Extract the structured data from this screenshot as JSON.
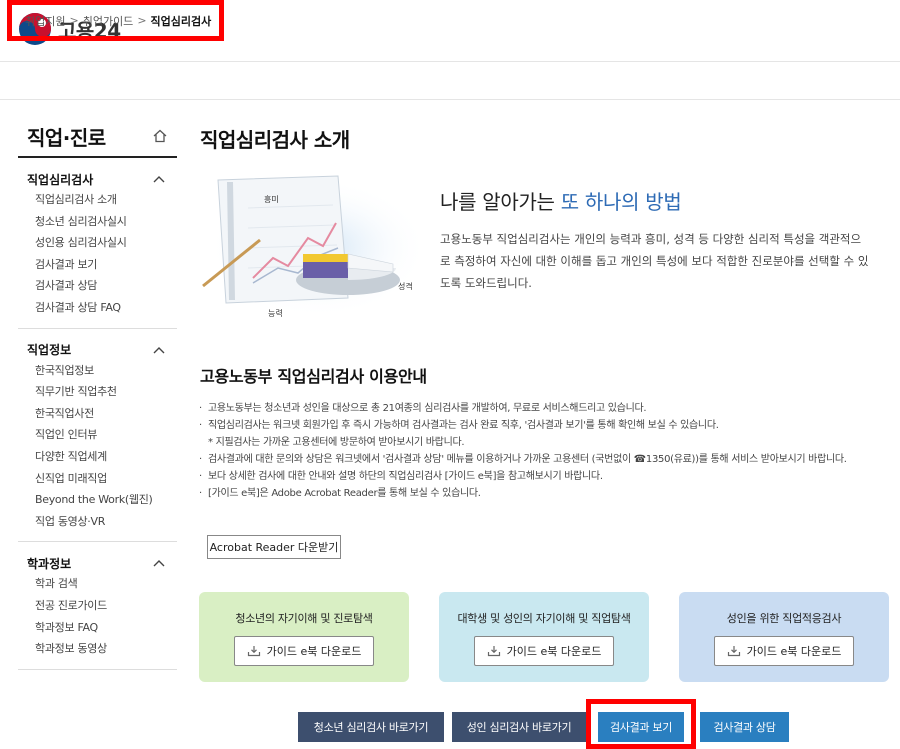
{
  "header": {
    "logo_text": "고용24",
    "logo_colors": {
      "red": "#c8102e",
      "blue": "#0e4a8a"
    }
  },
  "breadcrumb": {
    "items": [
      "취업지원",
      "취업가이드",
      "직업심리검사"
    ],
    "separator": ">"
  },
  "sidebar": {
    "title": "직업·진로",
    "groups": [
      {
        "label": "직업심리검사",
        "items": [
          "직업심리검사 소개",
          "청소년 심리검사실시",
          "성인용 심리검사실시",
          "검사결과 보기",
          "검사결과 상담",
          "검사결과 상담 FAQ"
        ]
      },
      {
        "label": "직업정보",
        "items": [
          "한국직업정보",
          "직무기반 직업추천",
          "한국직업사전",
          "직업인 인터뷰",
          "다양한 직업세계",
          "신직업 미래직업",
          "Beyond the Work(웹진)",
          "직업 동영상·VR"
        ]
      },
      {
        "label": "학과정보",
        "items": [
          "학과 검색",
          "전공 진로가이드",
          "학과정보 FAQ",
          "학과정보 동영상"
        ]
      }
    ]
  },
  "main": {
    "title": "직업심리검사 소개",
    "illustration_labels": {
      "interest": "흥미",
      "personality": "성격",
      "ability": "능력"
    },
    "intro": {
      "heading_prefix": "나를 알아가는 ",
      "heading_accent": "또 하나의 방법",
      "accent_color": "#2e6bb5",
      "body": "고용노동부 직업심리검사는 개인의 능력과 흥미, 성격 등 다양한 심리적 특성을 객관적으로 측정하여 자신에 대한 이해를 돕고 개인의 특성에 보다 적합한 진로분야를 선택할 수 있도록 도와드립니다."
    },
    "guide": {
      "title": "고용노동부 직업심리검사 이용안내",
      "bullets": [
        "고용노동부는 청소년과 성인을 대상으로 총 21여종의 심리검사를 개발하여, 무료로 서비스해드리고 있습니다.",
        "직업심리검사는 워크넷 회원가입 후 즉시 가능하며 검사결과는 검사 완료 직후, '검사결과 보기'를 통해 확인해 보실 수 있습니다.",
        "* 지필검사는 가까운 고용센터에 방문하여 받아보시기 바랍니다.",
        "검사결과에 대한 문의와 상담은 워크넷에서 '검사결과 상담' 메뉴를 이용하거나 가까운 고용센터 (국번없이 ☎1350(유료))를 통해 서비스 받아보시기 바랍니다.",
        "보다 상세한 검사에 대한 안내와 설명 하단의 직업심리검사 [가이드 e북]을 참고해보시기 바랍니다.",
        "[가이드 e북]은 Adobe Acrobat Reader를 통해 보실 수 있습니다."
      ],
      "acrobat_button": "Acrobat Reader 다운받기"
    },
    "cards": [
      {
        "title": "청소년의 자기이해 및 진로탐색",
        "button": "가이드 e북 다운로드",
        "bg": "#d9efc4"
      },
      {
        "title": "대학생 및 성인의 자기이해 및 직업탐색",
        "button": "가이드 e북 다운로드",
        "bg": "#c9e8f0"
      },
      {
        "title": "성인을 위한 직업적응검사",
        "button": "가이드 e북 다운로드",
        "bg": "#c9dcf2"
      }
    ],
    "bottom_buttons": [
      {
        "label": "청소년 심리검사 바로가기",
        "bg": "#3d4f6e"
      },
      {
        "label": "성인 심리검사 바로가기",
        "bg": "#3d4f6e"
      },
      {
        "label": "검사결과 보기",
        "bg": "#2a7fc0"
      },
      {
        "label": "검사결과 상담",
        "bg": "#2a7fc0"
      }
    ]
  }
}
